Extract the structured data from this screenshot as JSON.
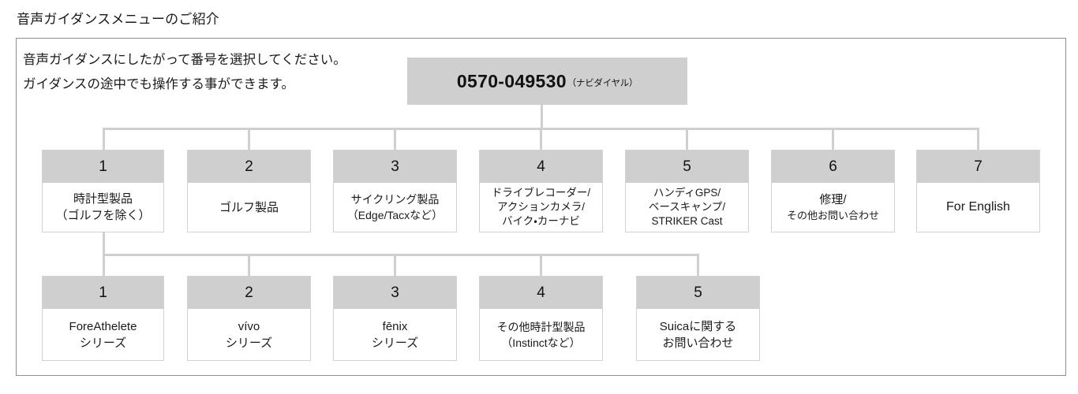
{
  "page_title": "音声ガイダンスメニューのご紹介",
  "intro": {
    "line1": "音声ガイダンスにしたがって番号を選択してください。",
    "line2": "ガイダンスの途中でも操作する事ができます。"
  },
  "root": {
    "number": "0570-049530",
    "suffix": "（ナビダイヤル）"
  },
  "colors": {
    "node_header": "#cfcfcf",
    "node_border": "#d2d2d2",
    "panel_border": "#8b8f93",
    "wire": "#cfcfcf",
    "text": "#1a1a1a"
  },
  "level1": [
    {
      "num": "1",
      "lines": [
        "時計型製品",
        "（ゴルフを除く）"
      ]
    },
    {
      "num": "2",
      "lines": [
        "ゴルフ製品"
      ]
    },
    {
      "num": "3",
      "lines": [
        "サイクリング製品",
        "（Edge/Tacxなど）"
      ]
    },
    {
      "num": "4",
      "lines": [
        "ドライブレコーダー/",
        "アクションカメラ/",
        "バイク・カーナビ"
      ]
    },
    {
      "num": "5",
      "lines": [
        "ハンディGPS/",
        "ベースキャンプ/",
        "STRIKER Cast"
      ]
    },
    {
      "num": "6",
      "lines": [
        "修理/",
        "その他お問い合わせ"
      ]
    },
    {
      "num": "7",
      "lines": [
        "For English"
      ]
    }
  ],
  "level2": [
    {
      "num": "1",
      "lines": [
        "ForeAthelete",
        "シリーズ"
      ]
    },
    {
      "num": "2",
      "lines": [
        "vívo",
        "シリーズ"
      ]
    },
    {
      "num": "3",
      "lines": [
        "fēnix",
        "シリーズ"
      ]
    },
    {
      "num": "4",
      "lines": [
        "その他時計型製品",
        "（Instinctなど）"
      ]
    },
    {
      "num": "5",
      "lines": [
        "Suicaに関する",
        "お問い合わせ"
      ]
    }
  ]
}
